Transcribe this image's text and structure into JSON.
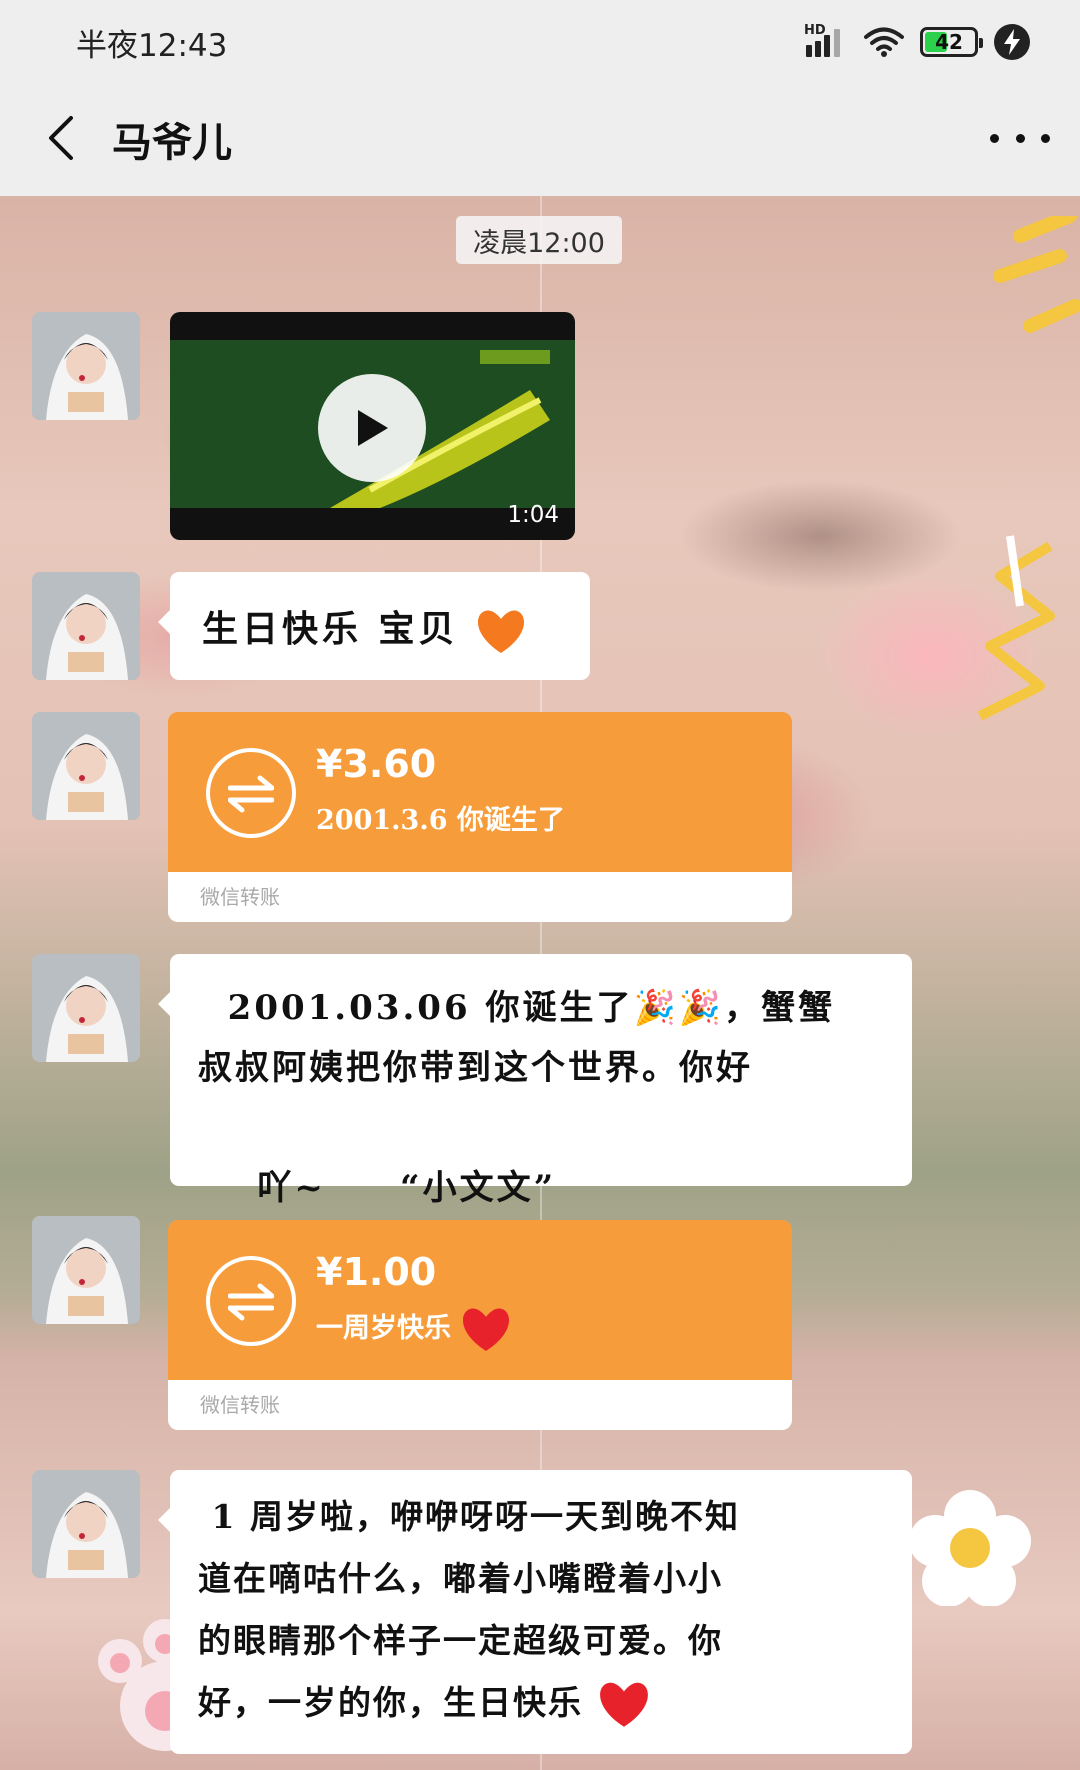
{
  "status_bar": {
    "time": "半夜12:43",
    "signal_label": "HD",
    "battery": "42"
  },
  "header": {
    "title": "马爷儿"
  },
  "chat": {
    "timestamp": "凌晨12:00",
    "video": {
      "duration": "1:04"
    },
    "message1": {
      "text": "生日快乐  宝贝"
    },
    "transfer1": {
      "amount": "¥3.60",
      "note": "2001.3.6  你诞生了",
      "label": "微信转账"
    },
    "message2": {
      "line1": "  2001.03.06 你诞生了🎉🎉，蟹蟹",
      "line2": "叔叔阿姨把你带到这个世界。你好",
      "line3": "吖~     “小文文”"
    },
    "transfer2": {
      "amount": "¥1.00",
      "note": "一周岁快乐",
      "label": "微信转账"
    },
    "message3": {
      "line1": " 1 周岁啦，咿咿呀呀一天到晚不知",
      "line2": "道在嘀咕什么，嘟着小嘴瞪着小小",
      "line3": "的眼睛那个样子一定超级可爱。你",
      "line4": "好，一岁的你，生日快乐"
    }
  },
  "colors": {
    "transfer_orange": "#f79c3a",
    "heart_red": "#e8222b",
    "battery_green": "#2bd14a"
  }
}
